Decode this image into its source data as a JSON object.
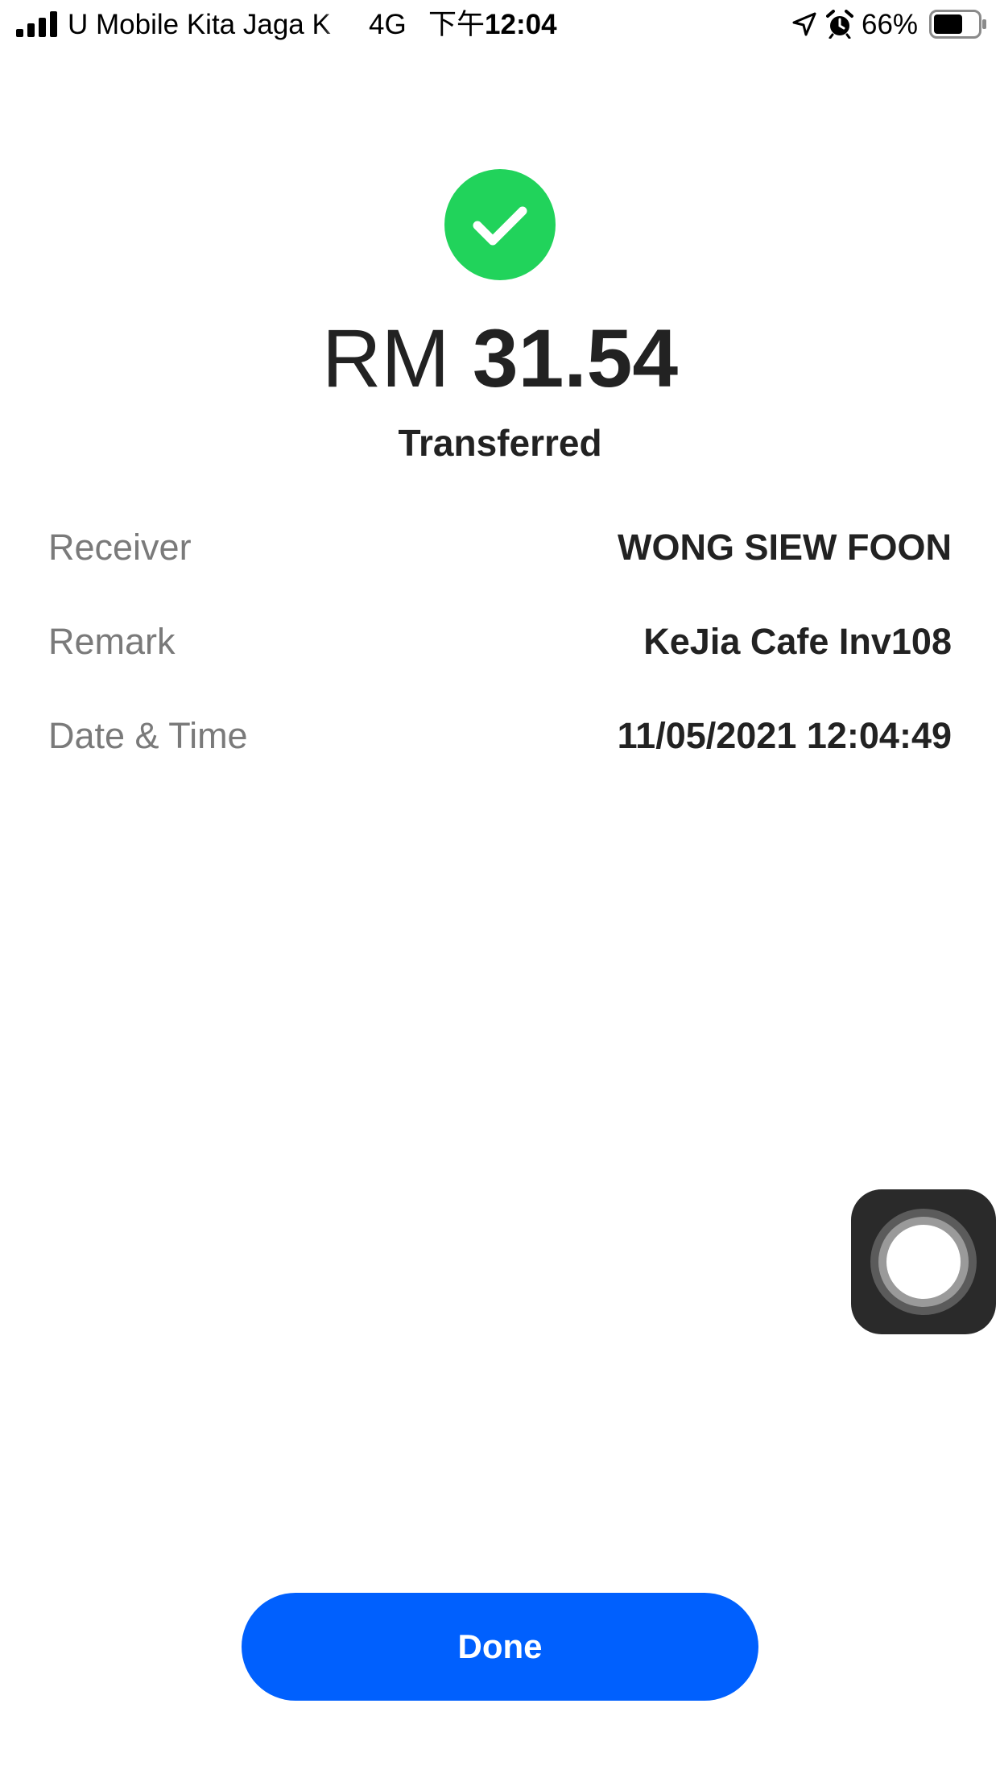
{
  "status_bar": {
    "carrier": "U Mobile Kita Jaga K",
    "network": "4G",
    "time_prefix": "下午",
    "time": "12:04",
    "battery_percent": "66%",
    "battery_level": 0.66,
    "icons": [
      "signal-icon",
      "location-icon",
      "alarm-icon",
      "battery-icon"
    ]
  },
  "transaction": {
    "status_icon": "checkmark-icon",
    "currency": "RM",
    "amount": "31.54",
    "status": "Transferred",
    "details": [
      {
        "label": "Receiver",
        "value": "WONG SIEW FOON"
      },
      {
        "label": "Remark",
        "value": "KeJia Cafe Inv108"
      },
      {
        "label": "Date & Time",
        "value": "11/05/2021 12:04:49"
      }
    ]
  },
  "actions": {
    "done_label": "Done"
  },
  "colors": {
    "success": "#21d35b",
    "primary": "#0060fe",
    "label": "#7a7a7a",
    "text": "#222222"
  }
}
